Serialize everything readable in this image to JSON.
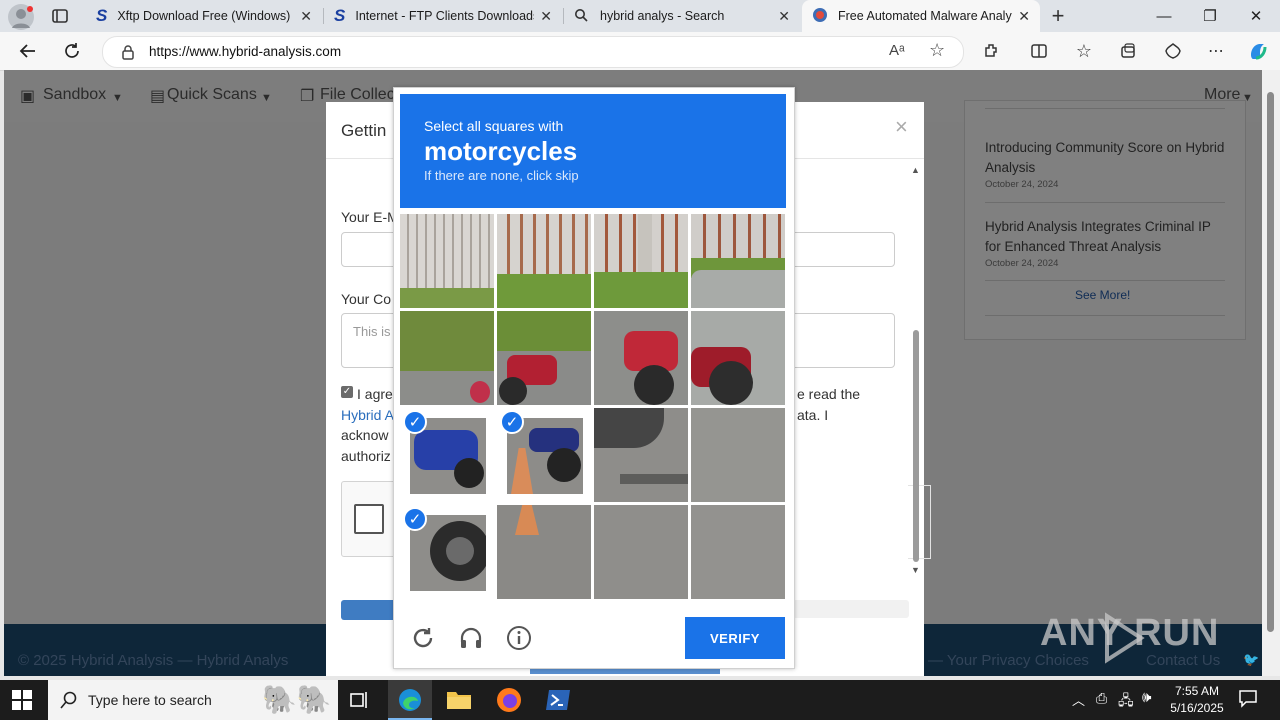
{
  "browser": {
    "tabs": [
      {
        "title": "Xftp Download Free (Windows) -",
        "icon": "softonic-s-icon"
      },
      {
        "title": "Internet - FTP Clients Downloads",
        "icon": "softonic-s-icon"
      },
      {
        "title": "hybrid analys - Search",
        "icon": "search-icon"
      },
      {
        "title": "Free Automated Malware Analysi",
        "icon": "hybrid-analysis-icon"
      }
    ],
    "url": "https://www.hybrid-analysis.com"
  },
  "site": {
    "nav": {
      "sandbox": "Sandbox",
      "quick_scans": "Quick Scans",
      "file_collections": "File Collec",
      "more": "More"
    },
    "news": [
      {
        "title": "Introducing Community Score on Hybrid Analysis",
        "date": "October 24, 2024"
      },
      {
        "title": "Hybrid Analysis Integrates Criminal IP for Enhanced Threat Analysis",
        "date": "October 24, 2024"
      }
    ],
    "see_more": "See More!",
    "footer_left": "© 2025 Hybrid Analysis — Hybrid Analys",
    "footer_right": "— Your Privacy Choices",
    "footer_contact": "Contact Us",
    "watermark": "ANY RUN"
  },
  "modal": {
    "title": "Gettin",
    "email_label": "Your E-M",
    "comment_label": "Your Co",
    "comment_placeholder": "This is",
    "agree_start": "I agre",
    "agree_right": "e read the",
    "link_text": "Hybrid A",
    "data_text": "ata. I",
    "acknow": "acknow",
    "authoriz": "authoriz"
  },
  "captcha": {
    "instruction": "Select all squares with",
    "target": "motorcycles",
    "hint": "If there are none, click skip",
    "verify_label": "VERIFY",
    "selected_tiles": [
      8,
      9,
      12
    ]
  },
  "taskbar": {
    "search_placeholder": "Type here to search",
    "time": "7:55 AM",
    "date": "5/16/2025"
  }
}
